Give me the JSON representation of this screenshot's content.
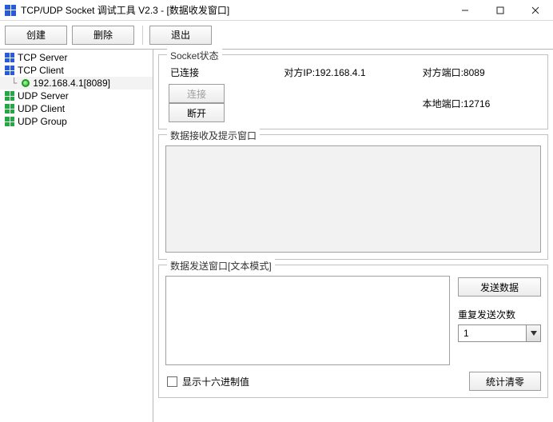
{
  "window": {
    "title": "TCP/UDP Socket 调试工具 V2.3 - [数据收发窗口]"
  },
  "toolbar": {
    "create": "创建",
    "delete": "删除",
    "exit": "退出"
  },
  "tree": {
    "tcp_server": "TCP Server",
    "tcp_client": "TCP Client",
    "tcp_client_child": "192.168.4.1[8089]",
    "udp_server": "UDP Server",
    "udp_client": "UDP Client",
    "udp_group": "UDP Group"
  },
  "socket": {
    "legend": "Socket状态",
    "status": "已连接",
    "peer_ip_label": "对方IP:",
    "peer_ip_value": "192.168.4.1",
    "peer_port_label": "对方端口:",
    "peer_port_value": "8089",
    "connect_btn": "连接",
    "disconnect_btn": "断开",
    "local_port_label": "本地端口:",
    "local_port_value": "12716"
  },
  "recv": {
    "legend": "数据接收及提示窗口"
  },
  "send": {
    "legend": "数据发送窗口[文本模式]",
    "send_btn": "发送数据",
    "repeat_label": "重复发送次数",
    "repeat_value": "1"
  },
  "bottom": {
    "hex_checkbox_label": "显示十六进制值",
    "clear_stats_btn": "统计清零"
  }
}
